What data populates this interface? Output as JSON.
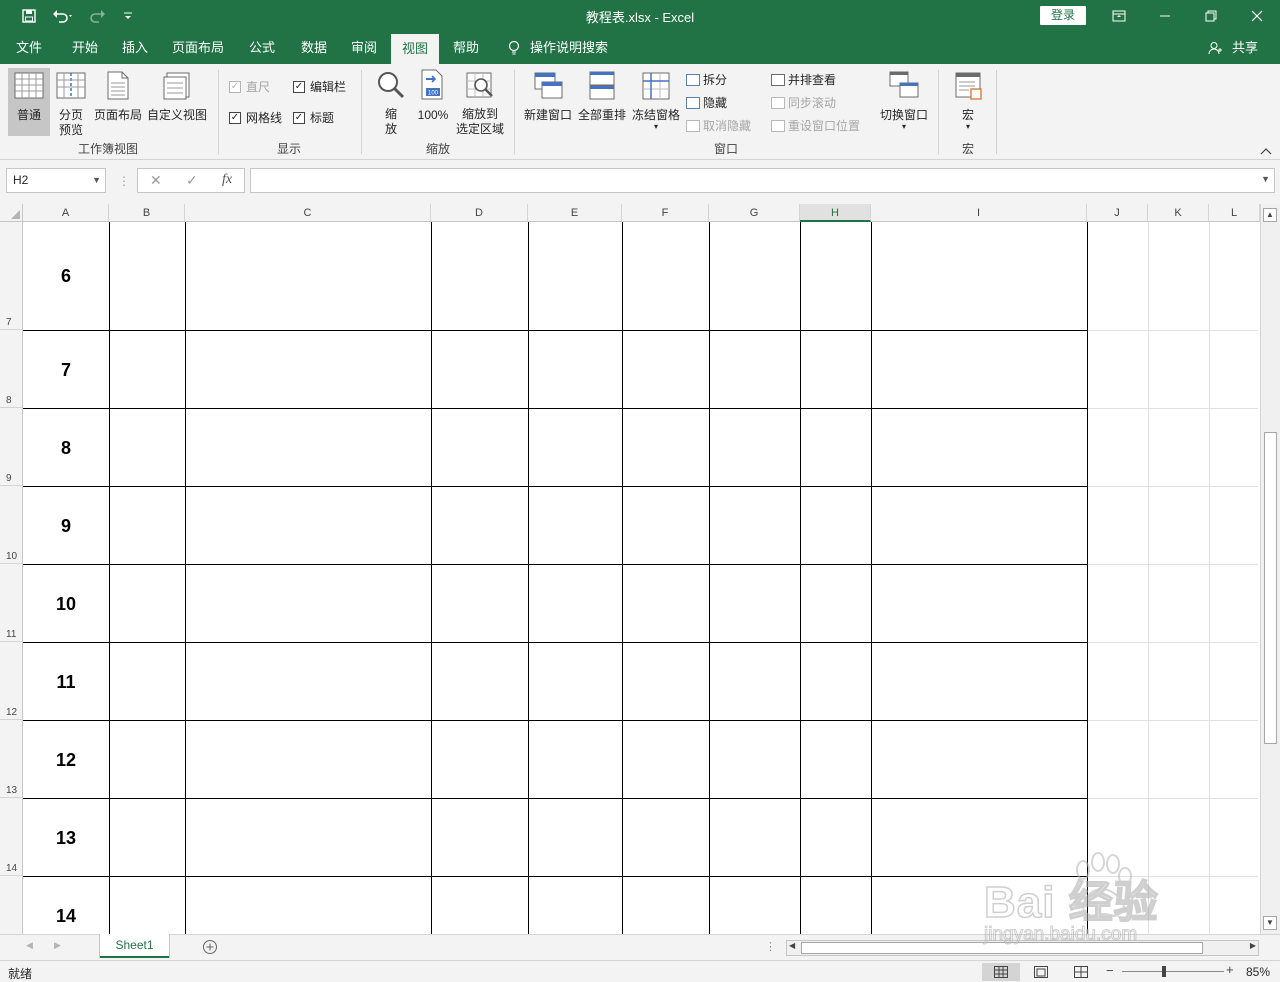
{
  "titlebar": {
    "title": "教程表.xlsx  -  Excel",
    "login_label": "登录"
  },
  "tabs": [
    "文件",
    "开始",
    "插入",
    "页面布局",
    "公式",
    "数据",
    "审阅",
    "视图",
    "帮助"
  ],
  "active_tab": "视图",
  "tell_me": "操作说明搜索",
  "share_label": "共享",
  "ribbon": {
    "workbook_views": {
      "group_label": "工作簿视图",
      "normal": "普通",
      "page_break_1": "分页",
      "page_break_2": "预览",
      "page_layout": "页面布局",
      "custom_views": "自定义视图"
    },
    "show": {
      "group_label": "显示",
      "ruler": "直尺",
      "formula_bar": "编辑栏",
      "gridlines": "网格线",
      "headings": "标题"
    },
    "zoom": {
      "group_label": "缩放",
      "zoom_1": "缩",
      "zoom_2": "放",
      "hundred": "100%",
      "zoom_sel_1": "缩放到",
      "zoom_sel_2": "选定区域"
    },
    "window": {
      "group_label": "窗口",
      "new_window": "新建窗口",
      "arrange_all": "全部重排",
      "freeze_panes": "冻结窗格",
      "split": "拆分",
      "hide": "隐藏",
      "unhide": "取消隐藏",
      "side_by_side": "并排查看",
      "sync_scroll": "同步滚动",
      "reset_position": "重设窗口位置",
      "switch_windows": "切换窗口"
    },
    "macros": {
      "group_label": "宏",
      "macros": "宏"
    }
  },
  "formula_bar": {
    "name_box": "H2",
    "fx": "fx",
    "value": ""
  },
  "columns": [
    "A",
    "B",
    "C",
    "D",
    "E",
    "F",
    "G",
    "H",
    "I",
    "J",
    "K",
    "L"
  ],
  "selected_column": "H",
  "row_headers": [
    "7",
    "8",
    "9",
    "10",
    "11",
    "12",
    "13",
    "14"
  ],
  "cell_values": [
    "6",
    "7",
    "8",
    "9",
    "10",
    "11",
    "12",
    "13",
    "14"
  ],
  "sheets": [
    "Sheet1"
  ],
  "status": {
    "ready": "就绪",
    "zoom_level": "85%"
  },
  "watermark": {
    "line1": "Bai 经验",
    "line2": "jingyan.baidu.com"
  }
}
